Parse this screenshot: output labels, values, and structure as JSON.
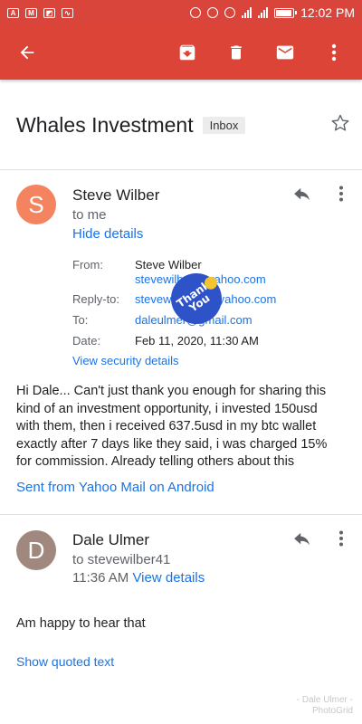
{
  "status": {
    "time": "12:02 PM",
    "left_icons": [
      "a-icon",
      "gmail-icon",
      "screenshot-icon",
      "activity-icon"
    ],
    "battery_level": 0.85
  },
  "appbar": {
    "actions": [
      "archive-icon",
      "delete-icon",
      "mark-unread-icon",
      "more-vert-icon"
    ]
  },
  "subject": {
    "title": "Whales Investment",
    "label": "Inbox"
  },
  "message1": {
    "avatar_letter": "S",
    "avatar_color": "#f4845f",
    "sender": "Steve Wilber",
    "to": "to me",
    "hide_details": "Hide details",
    "details": {
      "from_label": "From:",
      "from_name": "Steve Wilber",
      "from_email": "stevewilb41@yahoo.com",
      "reply_label": "Reply-to:",
      "reply_email": "stevewilber41@yahoo.com",
      "to_label": "To:",
      "to_email": "daleulmer@gmail.com",
      "date_label": "Date:",
      "date_value": "Feb 11, 2020, 11:30 AM",
      "security_link": "View security details"
    },
    "body_lines": [
      "Hi Dale... Can't just thank you enough for sharing this",
      "kind of an investment opportunity, i invested 150usd",
      "with them, then i received 637.5usd in my btc wallet",
      "exactly after 7 days like they said, i was charged 15%",
      "for commission. Already telling others about this"
    ],
    "signature": "Sent from Yahoo Mail on Android",
    "sticker_text": "Thank You"
  },
  "message2": {
    "avatar_letter": "D",
    "avatar_color": "#a1887f",
    "sender": "Dale Ulmer",
    "to": "to stevewilber41",
    "time": "11:36 AM",
    "view_details": "View details",
    "body": "Am happy to hear that",
    "quoted": "Show quoted text"
  },
  "watermark": {
    "line1": "- Dale Ulmer -",
    "line2": "PhotoGrid"
  }
}
